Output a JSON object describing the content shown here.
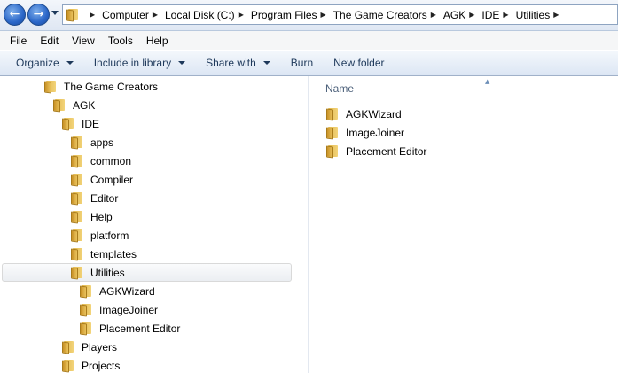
{
  "address": {
    "crumbs": [
      "Computer",
      "Local Disk (C:)",
      "Program Files",
      "The Game Creators",
      "AGK",
      "IDE",
      "Utilities"
    ]
  },
  "menu": [
    "File",
    "Edit",
    "View",
    "Tools",
    "Help"
  ],
  "toolbar": {
    "organize": "Organize",
    "include": "Include in library",
    "share": "Share with",
    "burn": "Burn",
    "new_folder": "New folder"
  },
  "tree": [
    {
      "label": "The Game Creators",
      "level": 0
    },
    {
      "label": "AGK",
      "level": 1
    },
    {
      "label": "IDE",
      "level": 2
    },
    {
      "label": "apps",
      "level": 3
    },
    {
      "label": "common",
      "level": 3
    },
    {
      "label": "Compiler",
      "level": 3
    },
    {
      "label": "Editor",
      "level": 3
    },
    {
      "label": "Help",
      "level": 3
    },
    {
      "label": "platform",
      "level": 3
    },
    {
      "label": "templates",
      "level": 3
    },
    {
      "label": "Utilities",
      "level": 3,
      "selected": true
    },
    {
      "label": "AGKWizard",
      "level": 4
    },
    {
      "label": "ImageJoiner",
      "level": 4
    },
    {
      "label": "Placement Editor",
      "level": 4
    },
    {
      "label": "Players",
      "level": 2
    },
    {
      "label": "Projects",
      "level": 2
    }
  ],
  "content": {
    "column_name": "Name",
    "items": [
      "AGKWizard",
      "ImageJoiner",
      "Placement Editor"
    ]
  },
  "icons": {
    "back": "back-arrow-icon",
    "forward": "forward-arrow-icon",
    "folder": "folder-icon"
  },
  "colors": {
    "folder": "#e9c25c",
    "selection": "#ebeef2"
  }
}
